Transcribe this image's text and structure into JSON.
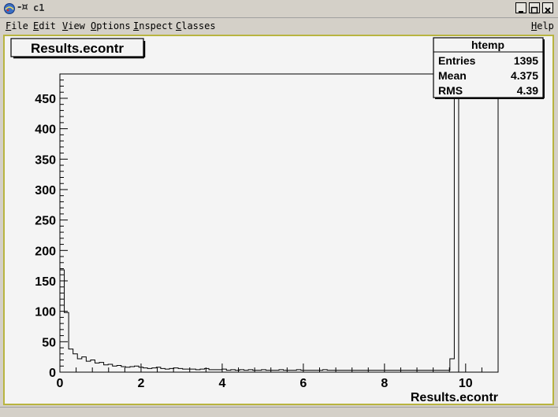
{
  "window": {
    "title": "c1"
  },
  "menu": {
    "items": [
      {
        "first": "F",
        "rest": "ile"
      },
      {
        "first": "E",
        "rest": "dit"
      },
      {
        "first": "V",
        "rest": "iew"
      },
      {
        "first": "O",
        "rest": "ptions"
      },
      {
        "first": "I",
        "rest": "nspect"
      },
      {
        "first": "C",
        "rest": "lasses"
      }
    ],
    "help": {
      "first": "H",
      "rest": "elp"
    }
  },
  "stats": {
    "title": "htemp",
    "rows": [
      {
        "label": "Entries",
        "value": "1395"
      },
      {
        "label": "Mean",
        "value": "4.375"
      },
      {
        "label": "RMS",
        "value": "4.39"
      }
    ]
  },
  "colors": {
    "frame": "#b8b440",
    "line": "#000000",
    "pad": "#f4f4f4"
  },
  "chart_data": {
    "type": "bar",
    "title": "Results.econtr",
    "xlabel": "Results.econtr",
    "ylabel": "",
    "xlim": [
      0,
      10.8
    ],
    "ylim": [
      0,
      490
    ],
    "x_ticks": [
      0,
      2,
      4,
      6,
      8,
      10
    ],
    "y_ticks": [
      0,
      50,
      100,
      150,
      200,
      250,
      300,
      350,
      400,
      450
    ],
    "bin_width": 0.108,
    "grid": false,
    "values": [
      168,
      98,
      38,
      30,
      22,
      25,
      18,
      20,
      15,
      16,
      12,
      13,
      10,
      11,
      9,
      8,
      9,
      10,
      8,
      7,
      6,
      7,
      8,
      6,
      5,
      6,
      7,
      6,
      5,
      5,
      5,
      4,
      5,
      6,
      4,
      4,
      4,
      5,
      3,
      4,
      3,
      4,
      3,
      4,
      3,
      3,
      4,
      3,
      3,
      3,
      4,
      3,
      3,
      3,
      4,
      3,
      3,
      3,
      3,
      3,
      4,
      3,
      3,
      3,
      3,
      3,
      3,
      3,
      3,
      3,
      3,
      3,
      3,
      3,
      3,
      3,
      3,
      3,
      3,
      3,
      3,
      3,
      3,
      3,
      3,
      3,
      3,
      3,
      3,
      22,
      490,
      0,
      0,
      0,
      0,
      0,
      0,
      0,
      0,
      0
    ]
  }
}
